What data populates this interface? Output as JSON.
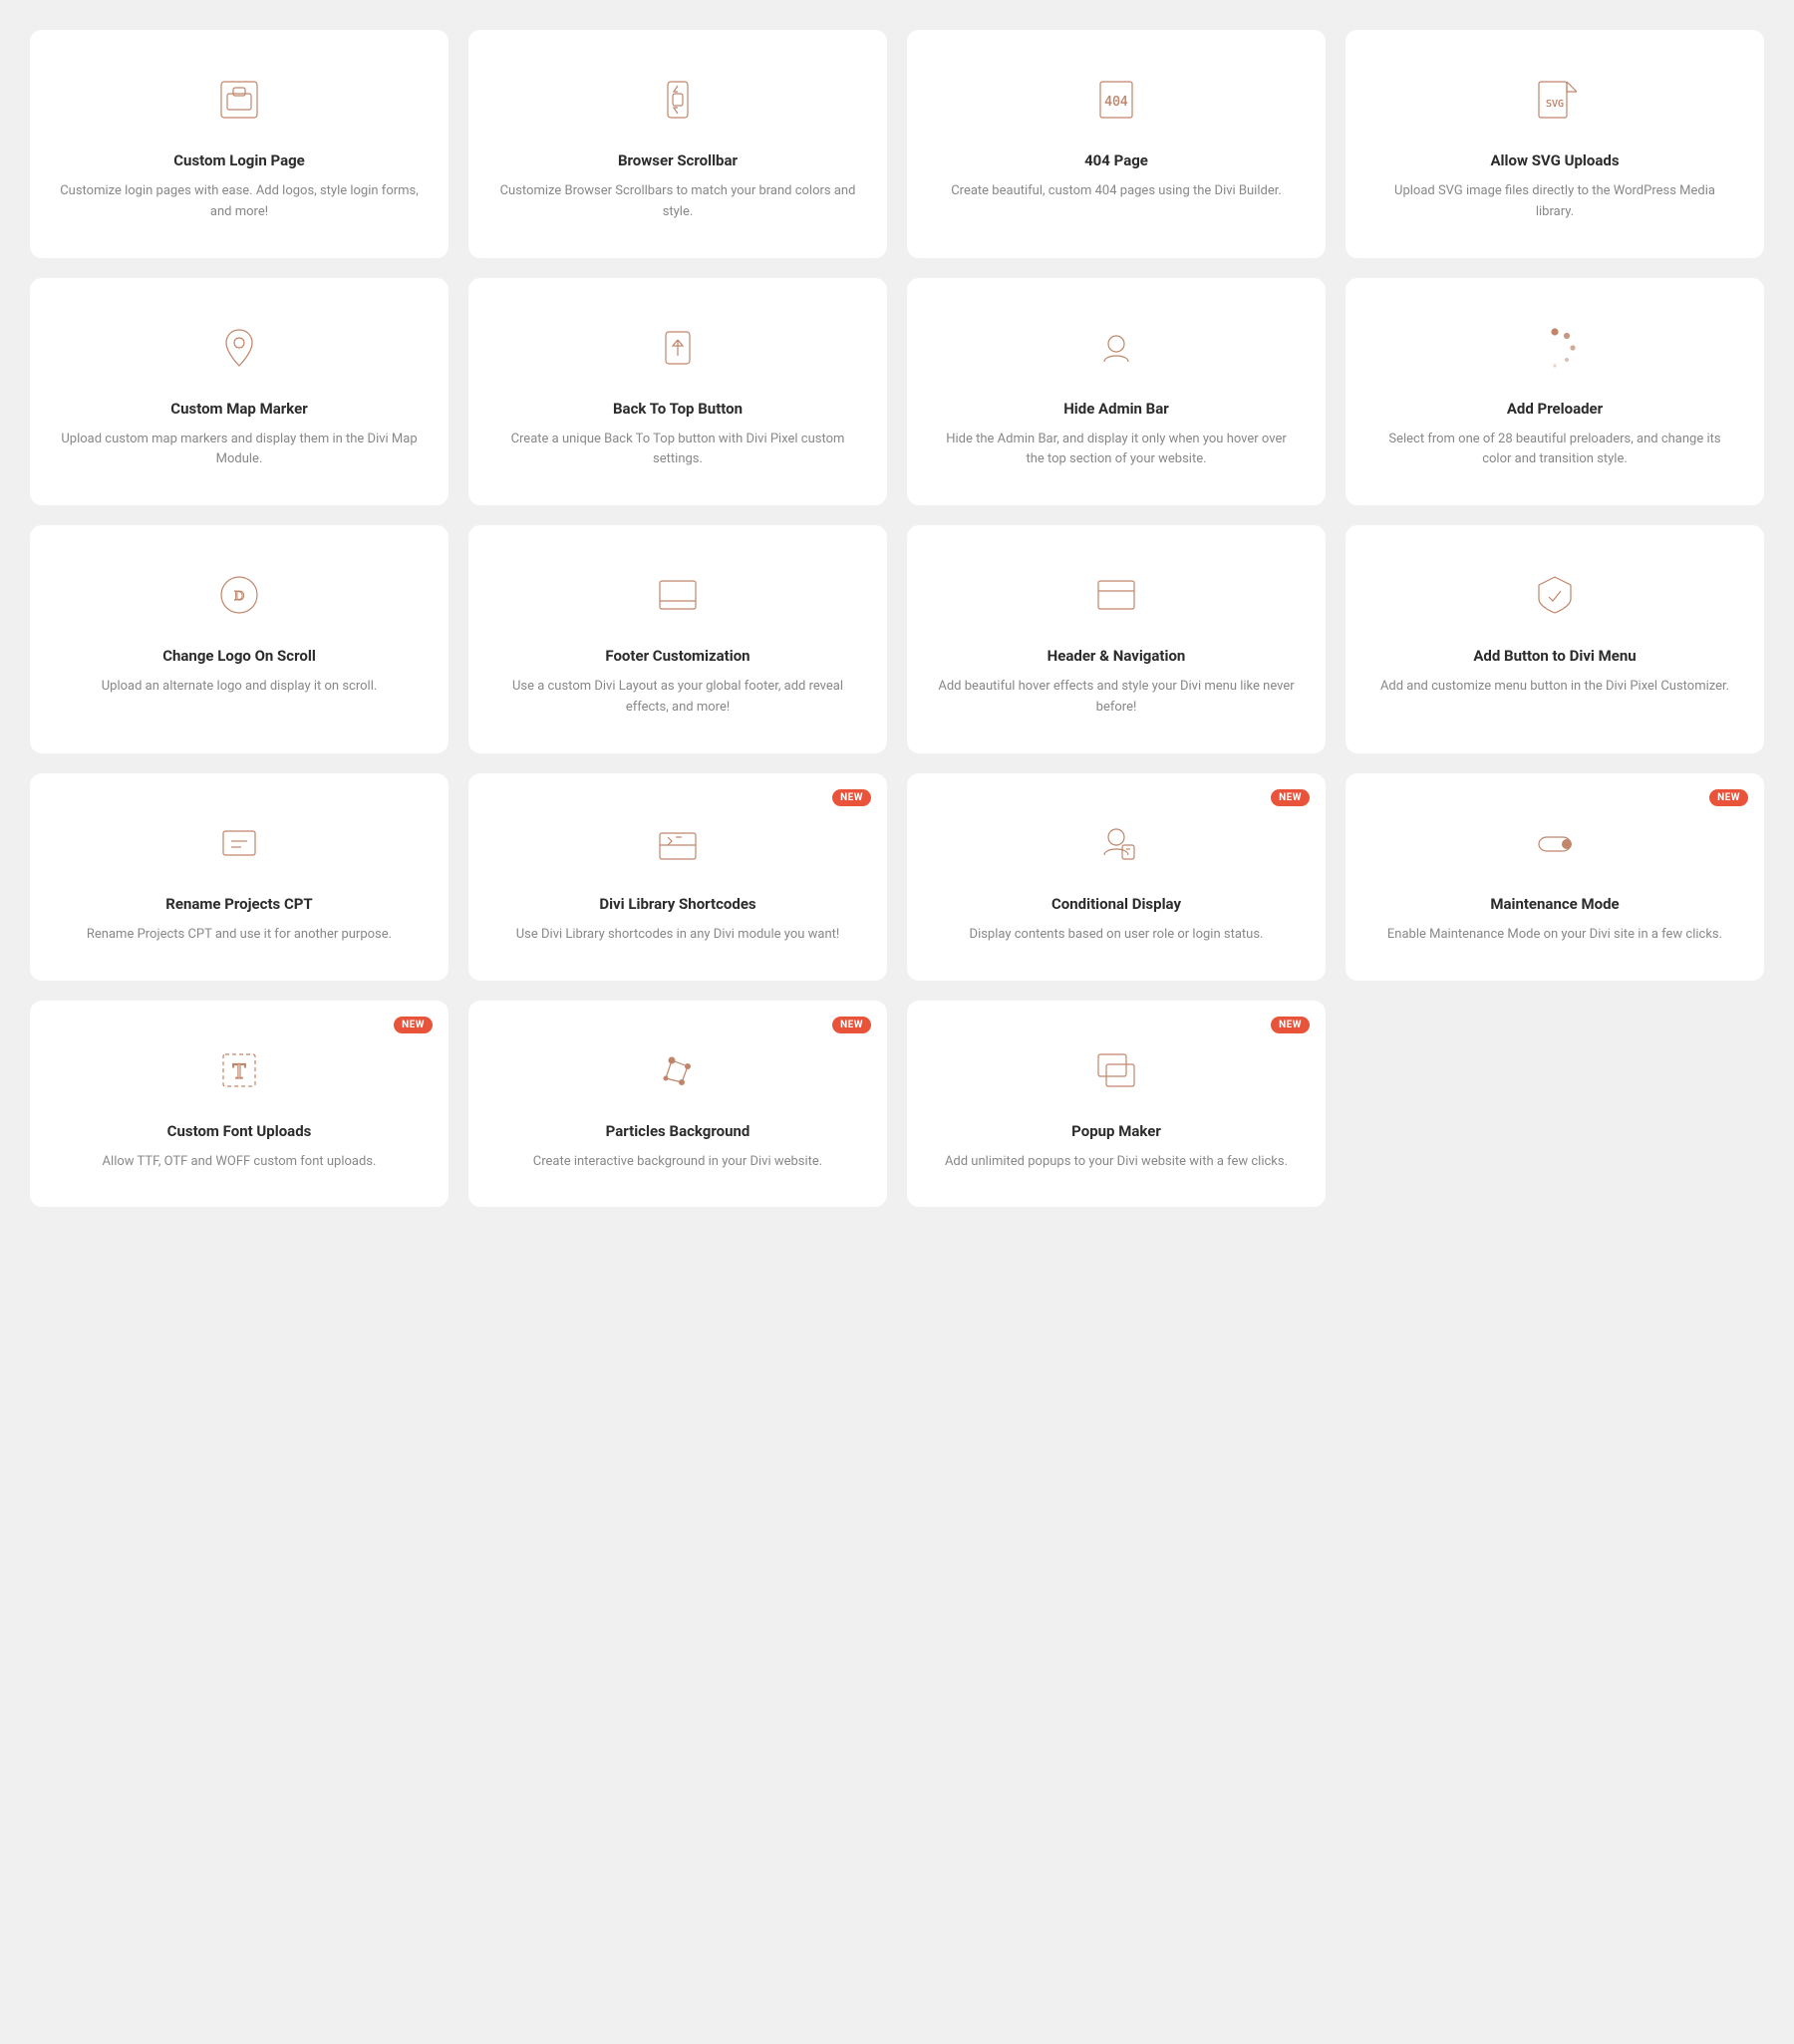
{
  "cards": [
    {
      "id": "custom-login-page",
      "title": "Custom Login Page",
      "desc": "Customize login pages with ease. Add logos, style login forms, and more!",
      "icon": "login",
      "badge": null
    },
    {
      "id": "browser-scrollbar",
      "title": "Browser Scrollbar",
      "desc": "Customize Browser Scrollbars to match your brand colors and style.",
      "icon": "scrollbar",
      "badge": null
    },
    {
      "id": "404-page",
      "title": "404 Page",
      "desc": "Create beautiful, custom 404 pages using the Divi Builder.",
      "icon": "404",
      "badge": null
    },
    {
      "id": "allow-svg-uploads",
      "title": "Allow SVG Uploads",
      "desc": "Upload SVG image files directly to the WordPress Media library.",
      "icon": "svg",
      "badge": null
    },
    {
      "id": "custom-map-marker",
      "title": "Custom Map Marker",
      "desc": "Upload custom map markers and display them in the Divi Map Module.",
      "icon": "map-marker",
      "badge": null
    },
    {
      "id": "back-to-top-button",
      "title": "Back To Top Button",
      "desc": "Create a unique Back To Top button with Divi Pixel custom settings.",
      "icon": "back-to-top",
      "badge": null
    },
    {
      "id": "hide-admin-bar",
      "title": "Hide Admin Bar",
      "desc": "Hide the Admin Bar, and display it only when you hover over the top section of your website.",
      "icon": "hide-admin",
      "badge": null
    },
    {
      "id": "add-preloader",
      "title": "Add Preloader",
      "desc": "Select from one of 28 beautiful preloaders, and change its color and transition style.",
      "icon": "preloader",
      "badge": null
    },
    {
      "id": "change-logo-on-scroll",
      "title": "Change Logo On Scroll",
      "desc": "Upload an alternate logo and display it on scroll.",
      "icon": "logo-scroll",
      "badge": null
    },
    {
      "id": "footer-customization",
      "title": "Footer Customization",
      "desc": "Use a custom Divi Layout as your global footer, add reveal effects, and more!",
      "icon": "footer",
      "badge": null
    },
    {
      "id": "header-navigation",
      "title": "Header & Navigation",
      "desc": "Add beautiful hover effects and style your Divi menu like never before!",
      "icon": "header-nav",
      "badge": null
    },
    {
      "id": "add-button-to-divi-menu",
      "title": "Add Button to Divi Menu",
      "desc": "Add and customize menu button in the Divi Pixel Customizer.",
      "icon": "menu-button",
      "badge": null
    },
    {
      "id": "rename-projects-cpt",
      "title": "Rename Projects CPT",
      "desc": "Rename Projects CPT and use it for another purpose.",
      "icon": "rename-cpt",
      "badge": null
    },
    {
      "id": "divi-library-shortcodes",
      "title": "Divi Library Shortcodes",
      "desc": "Use Divi Library shortcodes in any Divi module you want!",
      "icon": "shortcodes",
      "badge": "NEW"
    },
    {
      "id": "conditional-display",
      "title": "Conditional Display",
      "desc": "Display contents based on user role or login status.",
      "icon": "conditional",
      "badge": "NEW"
    },
    {
      "id": "maintenance-mode",
      "title": "Maintenance Mode",
      "desc": "Enable Maintenance Mode on your Divi site in a few clicks.",
      "icon": "maintenance",
      "badge": "NEW"
    },
    {
      "id": "custom-font-uploads",
      "title": "Custom Font Uploads",
      "desc": "Allow TTF, OTF and WOFF custom font uploads.",
      "icon": "fonts",
      "badge": "NEW"
    },
    {
      "id": "particles-background",
      "title": "Particles Background",
      "desc": "Create interactive background in your Divi website.",
      "icon": "particles",
      "badge": "NEW"
    },
    {
      "id": "popup-maker",
      "title": "Popup Maker",
      "desc": "Add unlimited popups to your Divi website with a few clicks.",
      "icon": "popup",
      "badge": "NEW"
    }
  ]
}
